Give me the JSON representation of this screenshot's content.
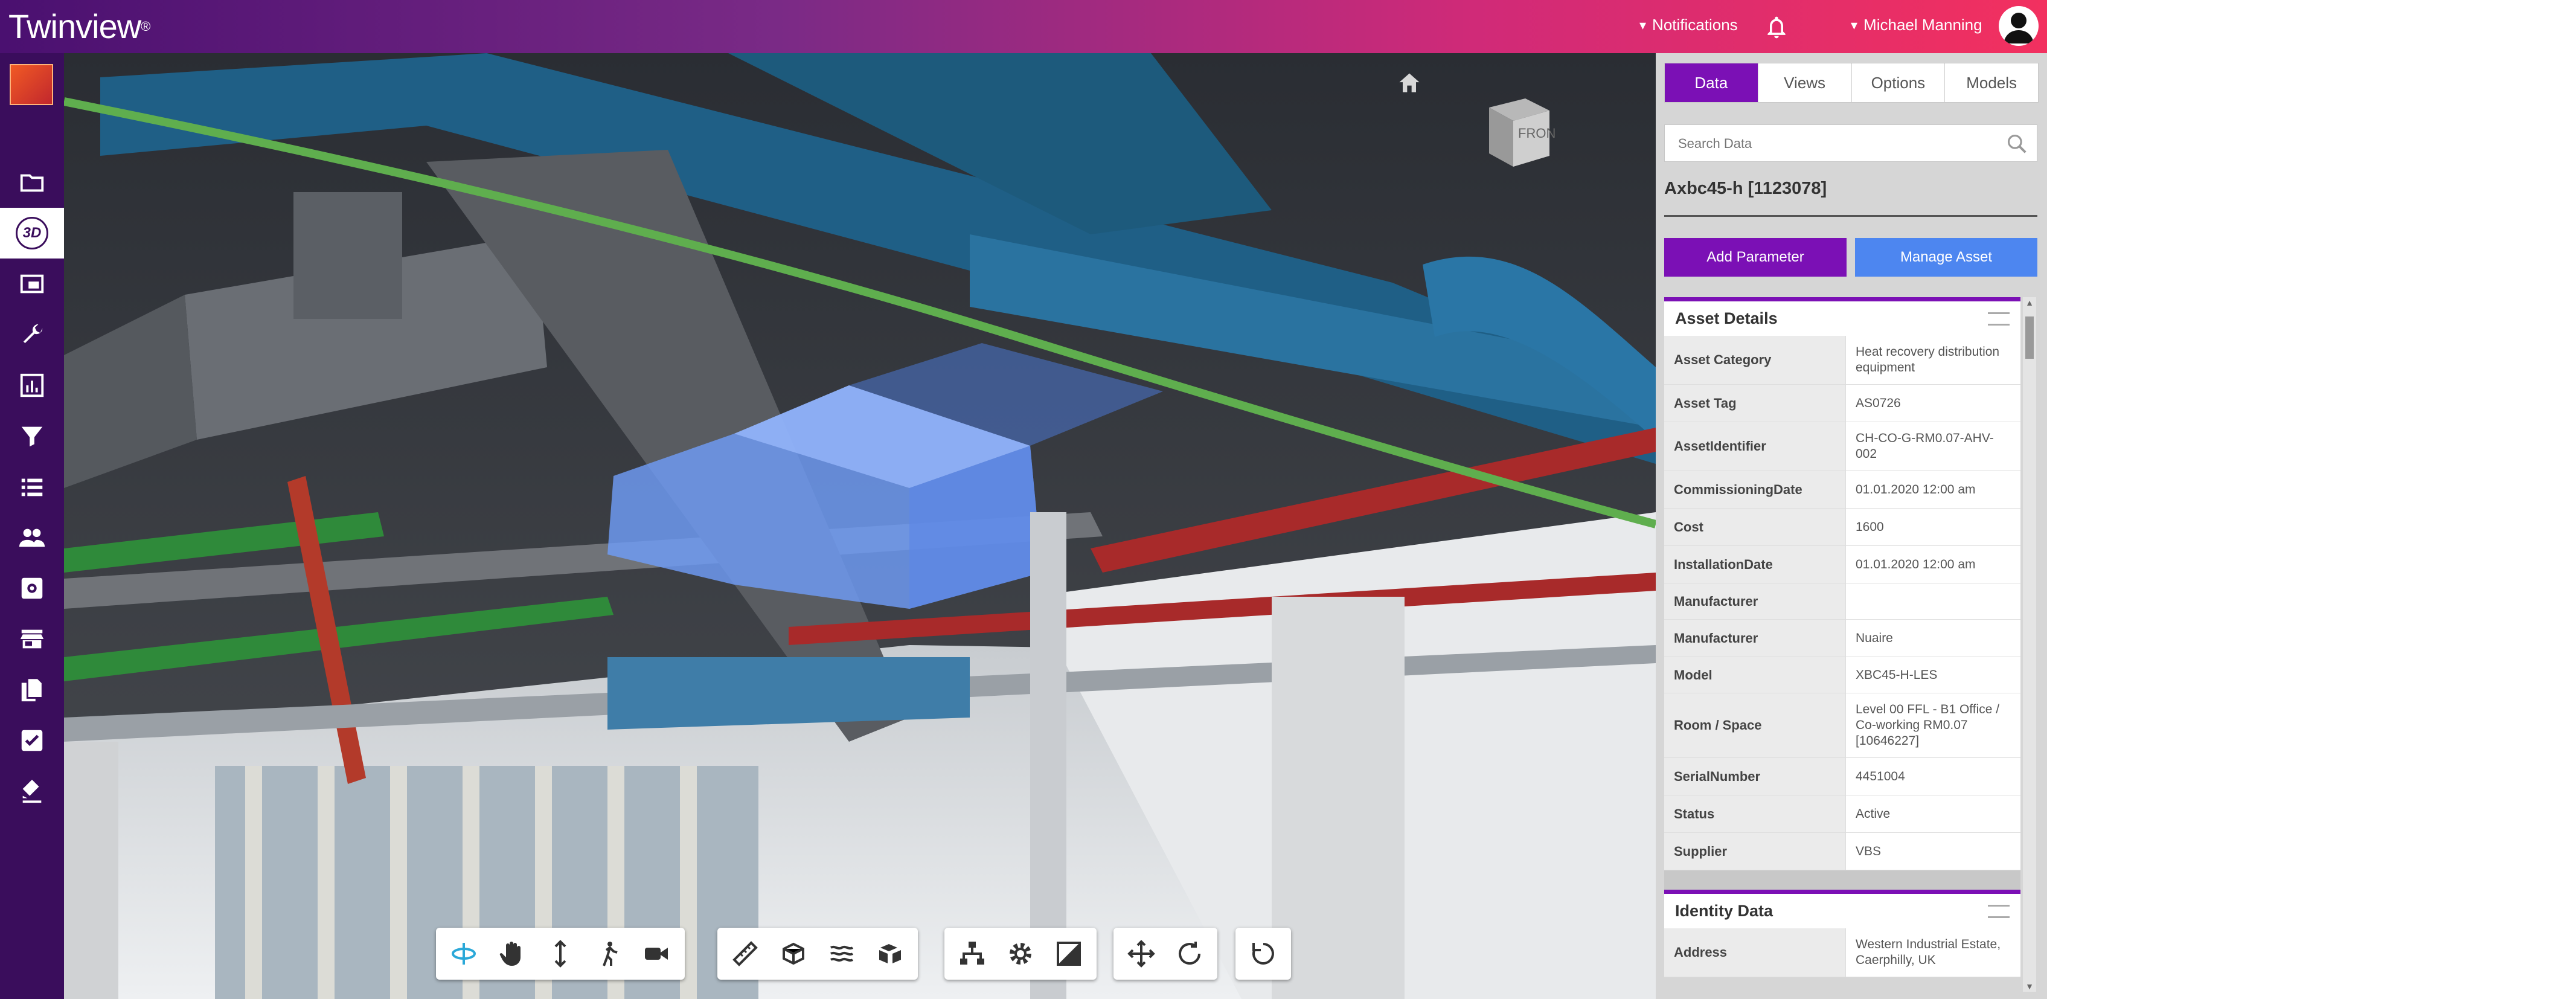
{
  "app": {
    "logo": "Twinview",
    "logo_mark": "®"
  },
  "topbar": {
    "notifications_label": "Notifications",
    "user_name": "Michael Manning"
  },
  "sidebar": {
    "items": [
      {
        "icon": "folder-icon"
      },
      {
        "icon": "3d-view-icon",
        "label": "3D",
        "active": true
      },
      {
        "icon": "slideshow-icon"
      },
      {
        "icon": "wrench-icon"
      },
      {
        "icon": "chart-icon"
      },
      {
        "icon": "filter-icon"
      },
      {
        "icon": "list-icon"
      },
      {
        "icon": "people-icon"
      },
      {
        "icon": "settings-box-icon"
      },
      {
        "icon": "store-icon"
      },
      {
        "icon": "documents-icon"
      },
      {
        "icon": "checklist-icon"
      },
      {
        "icon": "stamp-icon"
      }
    ]
  },
  "viewer": {
    "viewcube_label": "FRONT"
  },
  "panel": {
    "tabs": [
      "Data",
      "Views",
      "Options",
      "Models"
    ],
    "active_tab": "Data",
    "search_placeholder": "Search Data",
    "asset_title": "Axbc45-h [1123078]",
    "add_parameter": "Add Parameter",
    "manage_asset": "Manage Asset",
    "asset_details": {
      "title": "Asset Details",
      "rows": [
        {
          "key": "Asset Category",
          "value": "Heat recovery distribution equipment"
        },
        {
          "key": "Asset Tag",
          "value": "AS0726"
        },
        {
          "key": "AssetIdentifier",
          "value": "CH-CO-G-RM0.07-AHV-002"
        },
        {
          "key": "CommissioningDate",
          "value": "01.01.2020 12:00 am"
        },
        {
          "key": "Cost",
          "value": "1600"
        },
        {
          "key": "InstallationDate",
          "value": "01.01.2020 12:00 am"
        },
        {
          "key": "Manufacturer",
          "value": ""
        },
        {
          "key": "Manufacturer",
          "value": "Nuaire"
        },
        {
          "key": "Model",
          "value": "XBC45-H-LES"
        },
        {
          "key": "Room / Space",
          "value": "Level 00 FFL - B1 Office / Co-working RM0.07 [10646227]"
        },
        {
          "key": "SerialNumber",
          "value": "4451004"
        },
        {
          "key": "Status",
          "value": "Active"
        },
        {
          "key": "Supplier",
          "value": "VBS"
        }
      ]
    },
    "identity_data": {
      "title": "Identity Data",
      "rows": [
        {
          "key": "Address",
          "value": "Western Industrial Estate, Caerphilly, UK"
        }
      ]
    }
  },
  "colors": {
    "brand_purple": "#7b10b5",
    "manage_blue": "#4d86f0",
    "sidebar": "#3a0d5c"
  }
}
